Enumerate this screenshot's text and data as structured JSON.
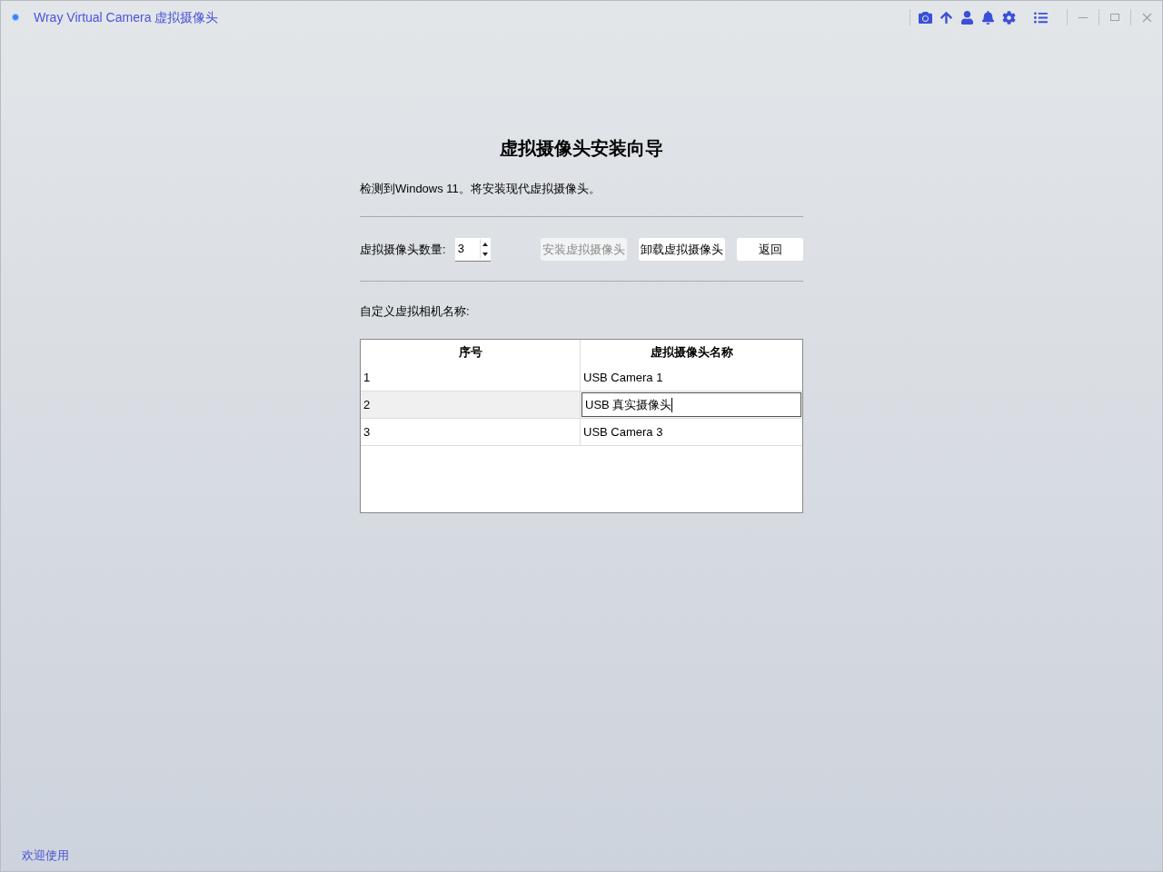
{
  "window": {
    "title": "Wray Virtual Camera 虚拟摄像头"
  },
  "heading": "虚拟摄像头安装向导",
  "detected": "检测到Windows 11。将安装现代虚拟摄像头。",
  "count": {
    "label": "虚拟摄像头数量:",
    "value": "3"
  },
  "buttons": [
    {
      "label": "安装虚拟摄像头",
      "disabled": true
    },
    {
      "label": "卸载虚拟摄像头",
      "disabled": false
    },
    {
      "label": "返回",
      "disabled": false
    }
  ],
  "names_label": "自定义虚拟相机名称:",
  "table": {
    "columns": [
      "序号",
      "虚拟摄像头名称"
    ],
    "rows": [
      {
        "index": "1",
        "name": "USB Camera 1",
        "selected": false,
        "editing": false
      },
      {
        "index": "2",
        "name": "USB 真实摄像头",
        "selected": true,
        "editing": true
      },
      {
        "index": "3",
        "name": "USB Camera 3",
        "selected": false,
        "editing": false
      }
    ]
  },
  "status_bar": "欢迎使用"
}
